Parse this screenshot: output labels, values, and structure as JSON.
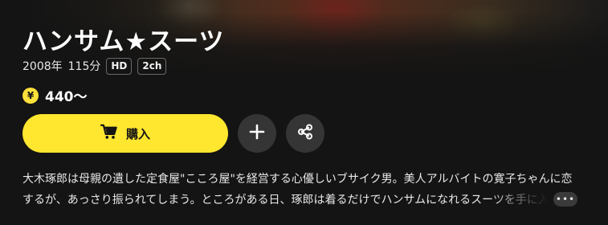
{
  "content": {
    "title": "ハンサム★スーツ",
    "year": "2008年",
    "duration": "115分",
    "badges": [
      "HD",
      "2ch"
    ],
    "price": {
      "currency_symbol": "¥",
      "value": "440〜"
    }
  },
  "actions": {
    "buy_label": "購入"
  },
  "description": {
    "line1": "大木琢郎は母親の遺した定食屋\"こころ屋\"を経営する心優しいブサイク男。美人アルバイトの寛子ちゃんに恋",
    "line2": "するが、あっさり振られてしまう。ところがある日、琢郎は着るだけでハンサムになれるスーツを手に入",
    "more_label": "•••"
  },
  "colors": {
    "accent": "#ffe62f",
    "background": "#141414",
    "round_button": "#353535"
  },
  "icons": {
    "cart": "cart-icon",
    "plus": "plus-icon",
    "share": "share-icon",
    "coin": "yen-coin-icon"
  }
}
